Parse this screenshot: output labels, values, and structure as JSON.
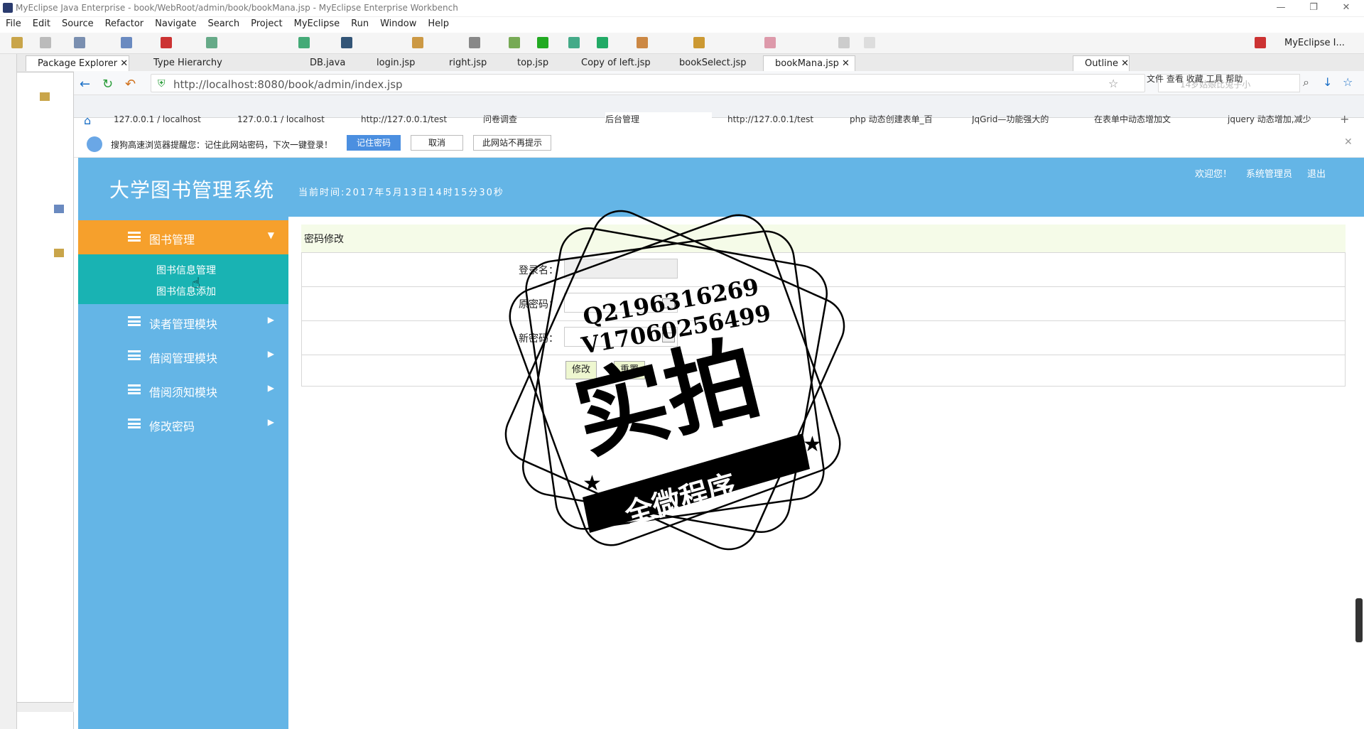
{
  "window": {
    "title": "MyEclipse Java Enterprise - book/WebRoot/admin/book/bookMana.jsp - MyEclipse Enterprise Workbench",
    "perspective": "MyEclipse I..."
  },
  "menubar": [
    "File",
    "Edit",
    "Source",
    "Refactor",
    "Navigate",
    "Search",
    "Project",
    "MyEclipse",
    "Run",
    "Window",
    "Help"
  ],
  "eclipse_tabs": {
    "package_explorer": "Package Explorer",
    "type_hierarchy": "Type Hierarchy",
    "editors": [
      "DB.java",
      "login.jsp",
      "right.jsp",
      "top.jsp",
      "Copy of left.jsp",
      "bookSelect.jsp",
      "bookMana.jsp"
    ],
    "outline": "Outline"
  },
  "browser": {
    "url": "http://localhost:8080/book/admin/index.jsp",
    "search_placeholder": "14岁姑娘比兔子小",
    "menu": [
      "文件",
      "查看",
      "收藏",
      "工具",
      "帮助"
    ],
    "tabs": [
      "127.0.0.1 / localhost",
      "127.0.0.1 / localhost",
      "http://127.0.0.1/test",
      "问卷调查",
      "后台管理",
      "http://127.0.0.1/test",
      "php 动态创建表单_百",
      "JqGrid—功能强大的",
      "在表单中动态增加文",
      "jquery 动态增加,减少"
    ],
    "active_tab": 4
  },
  "notification": {
    "text": "搜狗高速浏览器提醒您：记住此网站密码，下次一键登录！",
    "remember": "记住密码",
    "cancel": "取消",
    "never": "此网站不再提示"
  },
  "app": {
    "brand": "大学图书管理系统",
    "current_time": "当前时间:2017年5月13日14时15分30秒",
    "welcome": "欢迎您！",
    "user": "系统管理员",
    "logout": "退出"
  },
  "sidebar": {
    "active": "图书管理",
    "sub": [
      "图书信息管理",
      "图书信息添加"
    ],
    "items": [
      "读者管理模块",
      "借阅管理模块",
      "借阅须知模块",
      "修改密码"
    ]
  },
  "form": {
    "title": "密码修改",
    "login_label": "登录名：",
    "old_label": "原密码：",
    "new_label": "新密码：",
    "submit": "修改",
    "reset": "重置"
  },
  "stamp": {
    "line1": "Q2196316269",
    "line2": "V17060256499",
    "big": "实拍",
    "banner": "全微程序"
  }
}
